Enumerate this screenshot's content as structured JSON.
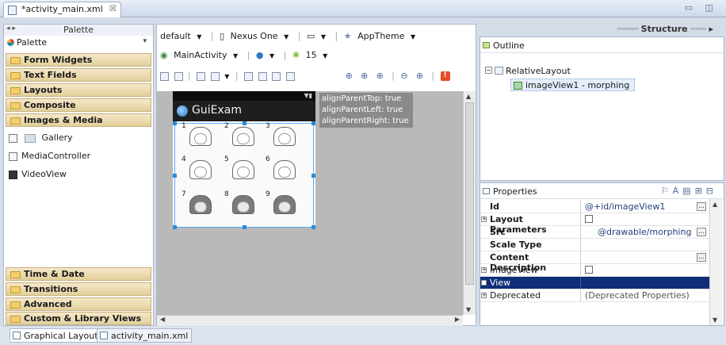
{
  "editor": {
    "tab_title": "*activity_main.xml",
    "close_glyph": "☒",
    "window_controls": "▭ ◫"
  },
  "palette": {
    "header": "Palette",
    "selector_label": "Palette",
    "categories_top": [
      "Form Widgets",
      "Text Fields",
      "Layouts",
      "Composite",
      "Images & Media"
    ],
    "items": [
      "Gallery",
      "MediaController",
      "VideoView"
    ],
    "categories_bottom": [
      "Time & Date",
      "Transitions",
      "Advanced",
      "Custom & Library Views"
    ]
  },
  "toolbar": {
    "config": "default",
    "device": "Nexus One",
    "theme": "AppTheme",
    "activity": "MainActivity",
    "api": "15"
  },
  "preview": {
    "app_title": "GuiExam",
    "hint_lines": [
      "alignParentTop: true",
      "alignParentLeft: true",
      "alignParentRight: true"
    ],
    "frame_numbers": [
      "1",
      "2",
      "3",
      "4",
      "5",
      "6",
      "7",
      "8",
      "9"
    ]
  },
  "bottom_tabs": {
    "graphical": "Graphical Layout",
    "xml": "activity_main.xml"
  },
  "structure": {
    "header": "Structure",
    "outline_title": "Outline",
    "tree_root": "RelativeLayout",
    "tree_child": "imageView1 - morphing"
  },
  "properties": {
    "title": "Properties",
    "rows": [
      {
        "key": "Id",
        "value": "@+id/imageView1"
      },
      {
        "key": "Layout Parameters",
        "value": ""
      },
      {
        "key": "Src",
        "value": "@drawable/morphing"
      },
      {
        "key": "Scale Type",
        "value": ""
      },
      {
        "key": "Content Description",
        "value": ""
      },
      {
        "key": "ImageView",
        "value": ""
      },
      {
        "key": "View",
        "value": ""
      },
      {
        "key": "Deprecated",
        "value": "(Deprecated Properties)"
      }
    ]
  },
  "colors": {
    "selection": "#0f2e78",
    "palette_category": "#e2cf9c",
    "selection_handle": "#2f8bd6"
  }
}
